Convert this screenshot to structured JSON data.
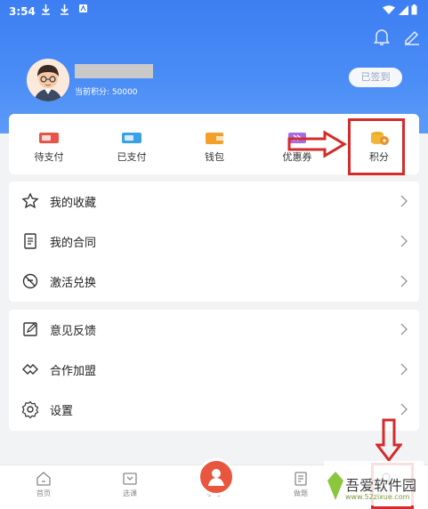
{
  "status_bar": {
    "time": "3:54"
  },
  "profile": {
    "points_label": "当前积分: 50000",
    "signed_button": "已签到"
  },
  "quick_actions": [
    {
      "label": "待支付",
      "icon": "pending-payment-icon"
    },
    {
      "label": "已支付",
      "icon": "paid-icon"
    },
    {
      "label": "钱包",
      "icon": "wallet-icon"
    },
    {
      "label": "优惠券",
      "icon": "coupon-icon"
    },
    {
      "label": "积分",
      "icon": "points-icon"
    }
  ],
  "menu_group_1": [
    {
      "label": "我的收藏",
      "icon": "star-icon"
    },
    {
      "label": "我的合同",
      "icon": "contract-icon"
    },
    {
      "label": "激活兑换",
      "icon": "activate-icon"
    }
  ],
  "menu_group_2": [
    {
      "label": "意见反馈",
      "icon": "feedback-icon"
    },
    {
      "label": "合作加盟",
      "icon": "partnership-icon"
    },
    {
      "label": "设置",
      "icon": "settings-icon"
    }
  ],
  "tabbar": [
    {
      "label": "首页",
      "icon": "home-icon"
    },
    {
      "label": "选课",
      "icon": "course-select-icon"
    },
    {
      "label": "学习",
      "icon": "study-icon"
    },
    {
      "label": "做题",
      "icon": "practice-icon"
    },
    {
      "label": "我的",
      "icon": "profile-icon"
    }
  ],
  "watermark": {
    "title": "吾爱软件园",
    "url": "www.52zixue.com"
  },
  "colors": {
    "header": "#4285f4",
    "annotation_red": "#d42b2b",
    "tab_active": "#e8563f"
  }
}
